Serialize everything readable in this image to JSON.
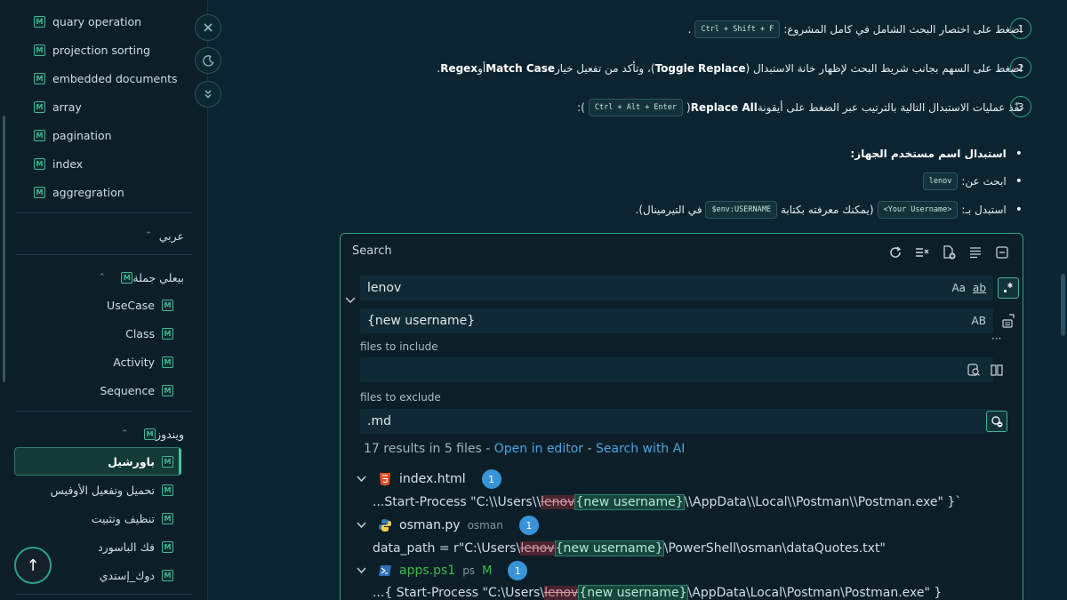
{
  "sidebar": {
    "top_items": [
      {
        "label": "quary operation"
      },
      {
        "label": "projection sorting"
      },
      {
        "label": "embedded documents"
      },
      {
        "label": "array"
      },
      {
        "label": "pagination"
      },
      {
        "label": "index"
      },
      {
        "label": "aggregration"
      }
    ],
    "group_arabic": {
      "label": "عربي"
    },
    "group_sentence": {
      "label": "بيعلي جملة",
      "items": [
        {
          "label": "UseCase"
        },
        {
          "label": "Class"
        },
        {
          "label": "Activity"
        },
        {
          "label": "Sequence"
        }
      ]
    },
    "group_windows": {
      "label": "ويندوز",
      "items": [
        {
          "label": "باورشيل",
          "active": true
        },
        {
          "label": "تحميل وتفعيل الأوفيس"
        },
        {
          "label": "تنظيف وتثبيت"
        },
        {
          "label": "فك الباسورد"
        },
        {
          "label": "دوك_إستدي"
        }
      ]
    },
    "badge_letter": "M",
    "scroll_top_icon": "arrow-up-icon"
  },
  "float_controls": [
    {
      "icon": "close-icon"
    },
    {
      "icon": "moon-icon"
    },
    {
      "icon": "chevrons-down-icon"
    }
  ],
  "steps": [
    {
      "num": "1",
      "text_before": "اضغط على اختصار البحث الشامل في كامل المشروع:",
      "kbd": "Ctrl + Shift + F",
      "text_after": "."
    },
    {
      "num": "2",
      "part1": "اضغط على السهم بجانب شريط البحث لإظهار خانة الاستبدال (",
      "bold1": "Toggle Replace",
      "part2": ")، وتأكد من تفعيل خيار ",
      "bold2": "Match Case",
      "part3": " أو ",
      "bold3": "Regex",
      "part4": "."
    },
    {
      "num": "3",
      "part1": "نفّذ عمليات الاستبدال التالية بالترتيب عبر الضغط على أيقونة ",
      "bold1": "Replace All",
      "part2": " (",
      "kbd": "Ctrl + Alt + Enter",
      "part3": "):"
    }
  ],
  "bullets": {
    "heading": "استبدال اسم مستخدم الجهاز:",
    "search_for": "ابحث عن:",
    "search_value": "lenov",
    "replace_with": "استبدل بـ:",
    "replace_value": "<Your Username>",
    "replace_hint_1": "(يمكنك معرفته بكتابة",
    "replace_hint_code": "$env:USERNAME",
    "replace_hint_2": "في التيرمينال)."
  },
  "search_panel": {
    "title": "Search",
    "search_value": "lenov",
    "match_case_label": "Aa",
    "whole_word_label": "ab",
    "replace_value": "{new username}",
    "preserve_case_label": "AB",
    "more_label": "···",
    "include_label": "files to include",
    "include_value": "",
    "exclude_label": "files to exclude",
    "exclude_value": ".md",
    "summary": "17 results in 5 files - ",
    "open_editor": "Open in editor",
    "sep": " - ",
    "search_ai": "Search with AI",
    "results": [
      {
        "file": "index.html",
        "extra": "",
        "extra_green": "",
        "count": "1",
        "pre": "...Start-Process \"C:\\\\Users\\\\",
        "match": "lenov",
        "repl": "{new username}",
        "post": "\\\\AppData\\\\Local\\\\Postman\\\\Postman.exe\" }`"
      },
      {
        "file": "osman.py",
        "extra": "osman",
        "extra_green": "",
        "count": "1",
        "pre": "data_path = r\"C:\\Users\\",
        "match": "lenov",
        "repl": "{new username}",
        "post": "\\PowerShell\\osman\\dataQuotes.txt\""
      },
      {
        "file": "apps.ps1",
        "extra": "ps",
        "extra_green": "M",
        "count": "1",
        "pre": "...{ Start-Process \"C:\\Users\\",
        "match": "lenov",
        "repl": "{new username}",
        "post": "\\AppData\\Local\\Postman\\Postman.exe\" }"
      }
    ]
  },
  "colors": {
    "accent": "#2aa187",
    "link": "#4aa3e0",
    "badge": "#3794d8",
    "background": "#0b2430"
  }
}
